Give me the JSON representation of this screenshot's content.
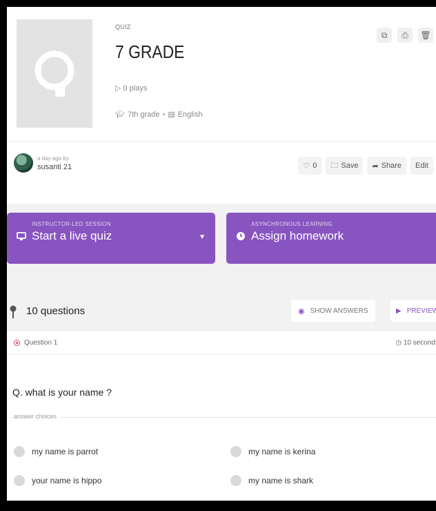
{
  "quiz": {
    "tag": "QUIZ",
    "title": "7 GRADE",
    "plays": "0 plays",
    "grade": "7th grade",
    "separator": "•",
    "language": "English"
  },
  "author": {
    "ago": "a day ago by",
    "name": "susanti 21"
  },
  "actions": {
    "like_count": "0",
    "save": "Save",
    "share": "Share",
    "edit": "Edit"
  },
  "sessions": {
    "live": {
      "sublabel": "INSTRUCTOR-LED SESSION",
      "label": "Start a live quiz"
    },
    "homework": {
      "sublabel": "ASYNCHRONOUS LEARNING",
      "label": "Assign homework"
    }
  },
  "questions_bar": {
    "count": "10 questions",
    "show_answers": "SHOW ANSWERS",
    "preview": "PREVIEW"
  },
  "question": {
    "number": "Question 1",
    "time": "10 seconds",
    "text": "Q. what is your name ?",
    "choices_label": "answer choices",
    "choices": [
      "my name is parrot",
      "my name is kerina",
      "your name is hippo",
      "my name is shark"
    ]
  },
  "colors": {
    "accent": "#8854c0",
    "question_marker": "#e5455e"
  }
}
